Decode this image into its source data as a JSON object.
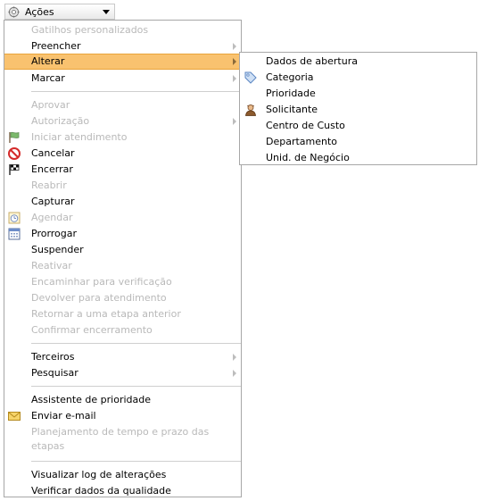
{
  "acoes_button": {
    "label": "Ações"
  },
  "menu": {
    "items": [
      {
        "label": "Gatilhos personalizados",
        "disabled": true
      },
      {
        "label": "Preencher",
        "submenu": true
      },
      {
        "label": "Alterar",
        "submenu": true,
        "active": true
      },
      {
        "label": "Marcar",
        "submenu": true
      },
      {
        "label": "Aprovar",
        "disabled": true
      },
      {
        "label": "Autorização",
        "disabled": true,
        "submenu": true
      },
      {
        "label": "Iniciar atendimento",
        "disabled": true,
        "icon": "green-flag-icon"
      },
      {
        "label": "Cancelar",
        "icon": "no-entry-icon"
      },
      {
        "label": "Encerrar",
        "icon": "checkered-flag-icon"
      },
      {
        "label": "Reabrir",
        "disabled": true
      },
      {
        "label": "Capturar"
      },
      {
        "label": "Agendar",
        "disabled": true,
        "icon": "clock-calendar-icon"
      },
      {
        "label": "Prorrogar",
        "icon": "calendar-icon"
      },
      {
        "label": "Suspender"
      },
      {
        "label": "Reativar",
        "disabled": true
      },
      {
        "label": "Encaminhar para verificação",
        "disabled": true
      },
      {
        "label": "Devolver para atendimento",
        "disabled": true
      },
      {
        "label": "Retornar a uma etapa anterior",
        "disabled": true
      },
      {
        "label": "Confirmar encerramento",
        "disabled": true
      },
      {
        "label": "Terceiros",
        "submenu": true
      },
      {
        "label": "Pesquisar",
        "submenu": true
      },
      {
        "label": "Assistente de prioridade"
      },
      {
        "label": "Enviar e-mail",
        "icon": "envelope-icon"
      },
      {
        "label": "Planejamento de tempo e prazo das etapas",
        "disabled": true
      },
      {
        "label": "Visualizar log de alterações"
      },
      {
        "label": "Verificar dados da qualidade"
      }
    ]
  },
  "submenu_alterar": {
    "items": [
      {
        "label": "Dados de abertura"
      },
      {
        "label": "Categoria",
        "icon": "tag-icon"
      },
      {
        "label": "Prioridade"
      },
      {
        "label": "Solicitante",
        "icon": "person-icon"
      },
      {
        "label": "Centro de Custo"
      },
      {
        "label": "Departamento"
      },
      {
        "label": "Unid. de Negócio"
      }
    ]
  },
  "colors": {
    "highlight": "#f9c26f",
    "disabled_text": "#b9b9b9",
    "border": "#a7a7a7"
  }
}
